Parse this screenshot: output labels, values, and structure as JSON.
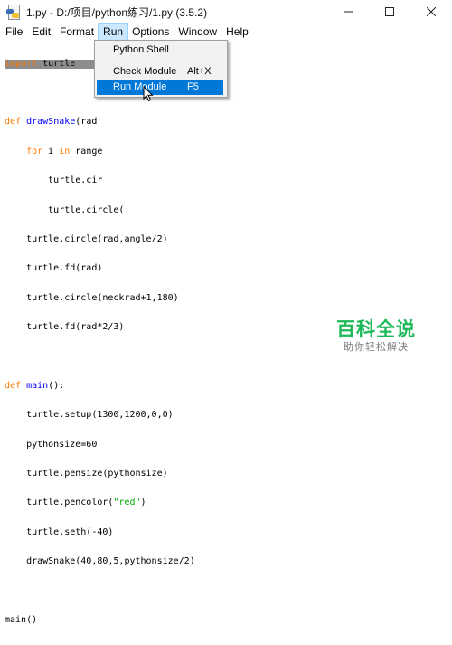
{
  "window": {
    "title": "1.py - D:/项目/python练习/1.py (3.5.2)"
  },
  "menubar": [
    {
      "label": "File"
    },
    {
      "label": "Edit"
    },
    {
      "label": "Format"
    },
    {
      "label": "Run",
      "active": true
    },
    {
      "label": "Options"
    },
    {
      "label": "Window"
    },
    {
      "label": "Help"
    }
  ],
  "run_menu": {
    "items": [
      {
        "label": "Python Shell",
        "accelerator": ""
      },
      {
        "label": "Check Module",
        "accelerator": "Alt+X"
      },
      {
        "label": "Run Module",
        "accelerator": "F5",
        "highlighted": true
      }
    ]
  },
  "editor": {
    "lines": [
      "import turtle",
      "",
      "def drawSnake(rad",
      "    for i in range",
      "        turtle.cir",
      "        turtle.circle(",
      "    turtle.circle(rad,angle/2)",
      "    turtle.fd(rad)",
      "    turtle.circle(neckrad+1,180)",
      "    turtle.fd(rad*2/3)",
      "",
      "def main():",
      "    turtle.setup(1300,1200,0,0)",
      "    pythonsize=60",
      "    turtle.pensize(pythonsize)",
      "    turtle.pencolor(\"red\")",
      "    turtle.seth(-40)",
      "    drawSnake(40,80,5,pythonsize/2)",
      "",
      "main()"
    ]
  },
  "colors": {
    "keyword": "#ff7700",
    "definition": "#0000ff",
    "string": "#00aa00",
    "menu_highlight": "#0078d7",
    "active_menu": "#cce8ff",
    "watermark": "#1db95a"
  },
  "watermark": {
    "title": "百科全说",
    "subtitle": "助你轻松解决"
  }
}
